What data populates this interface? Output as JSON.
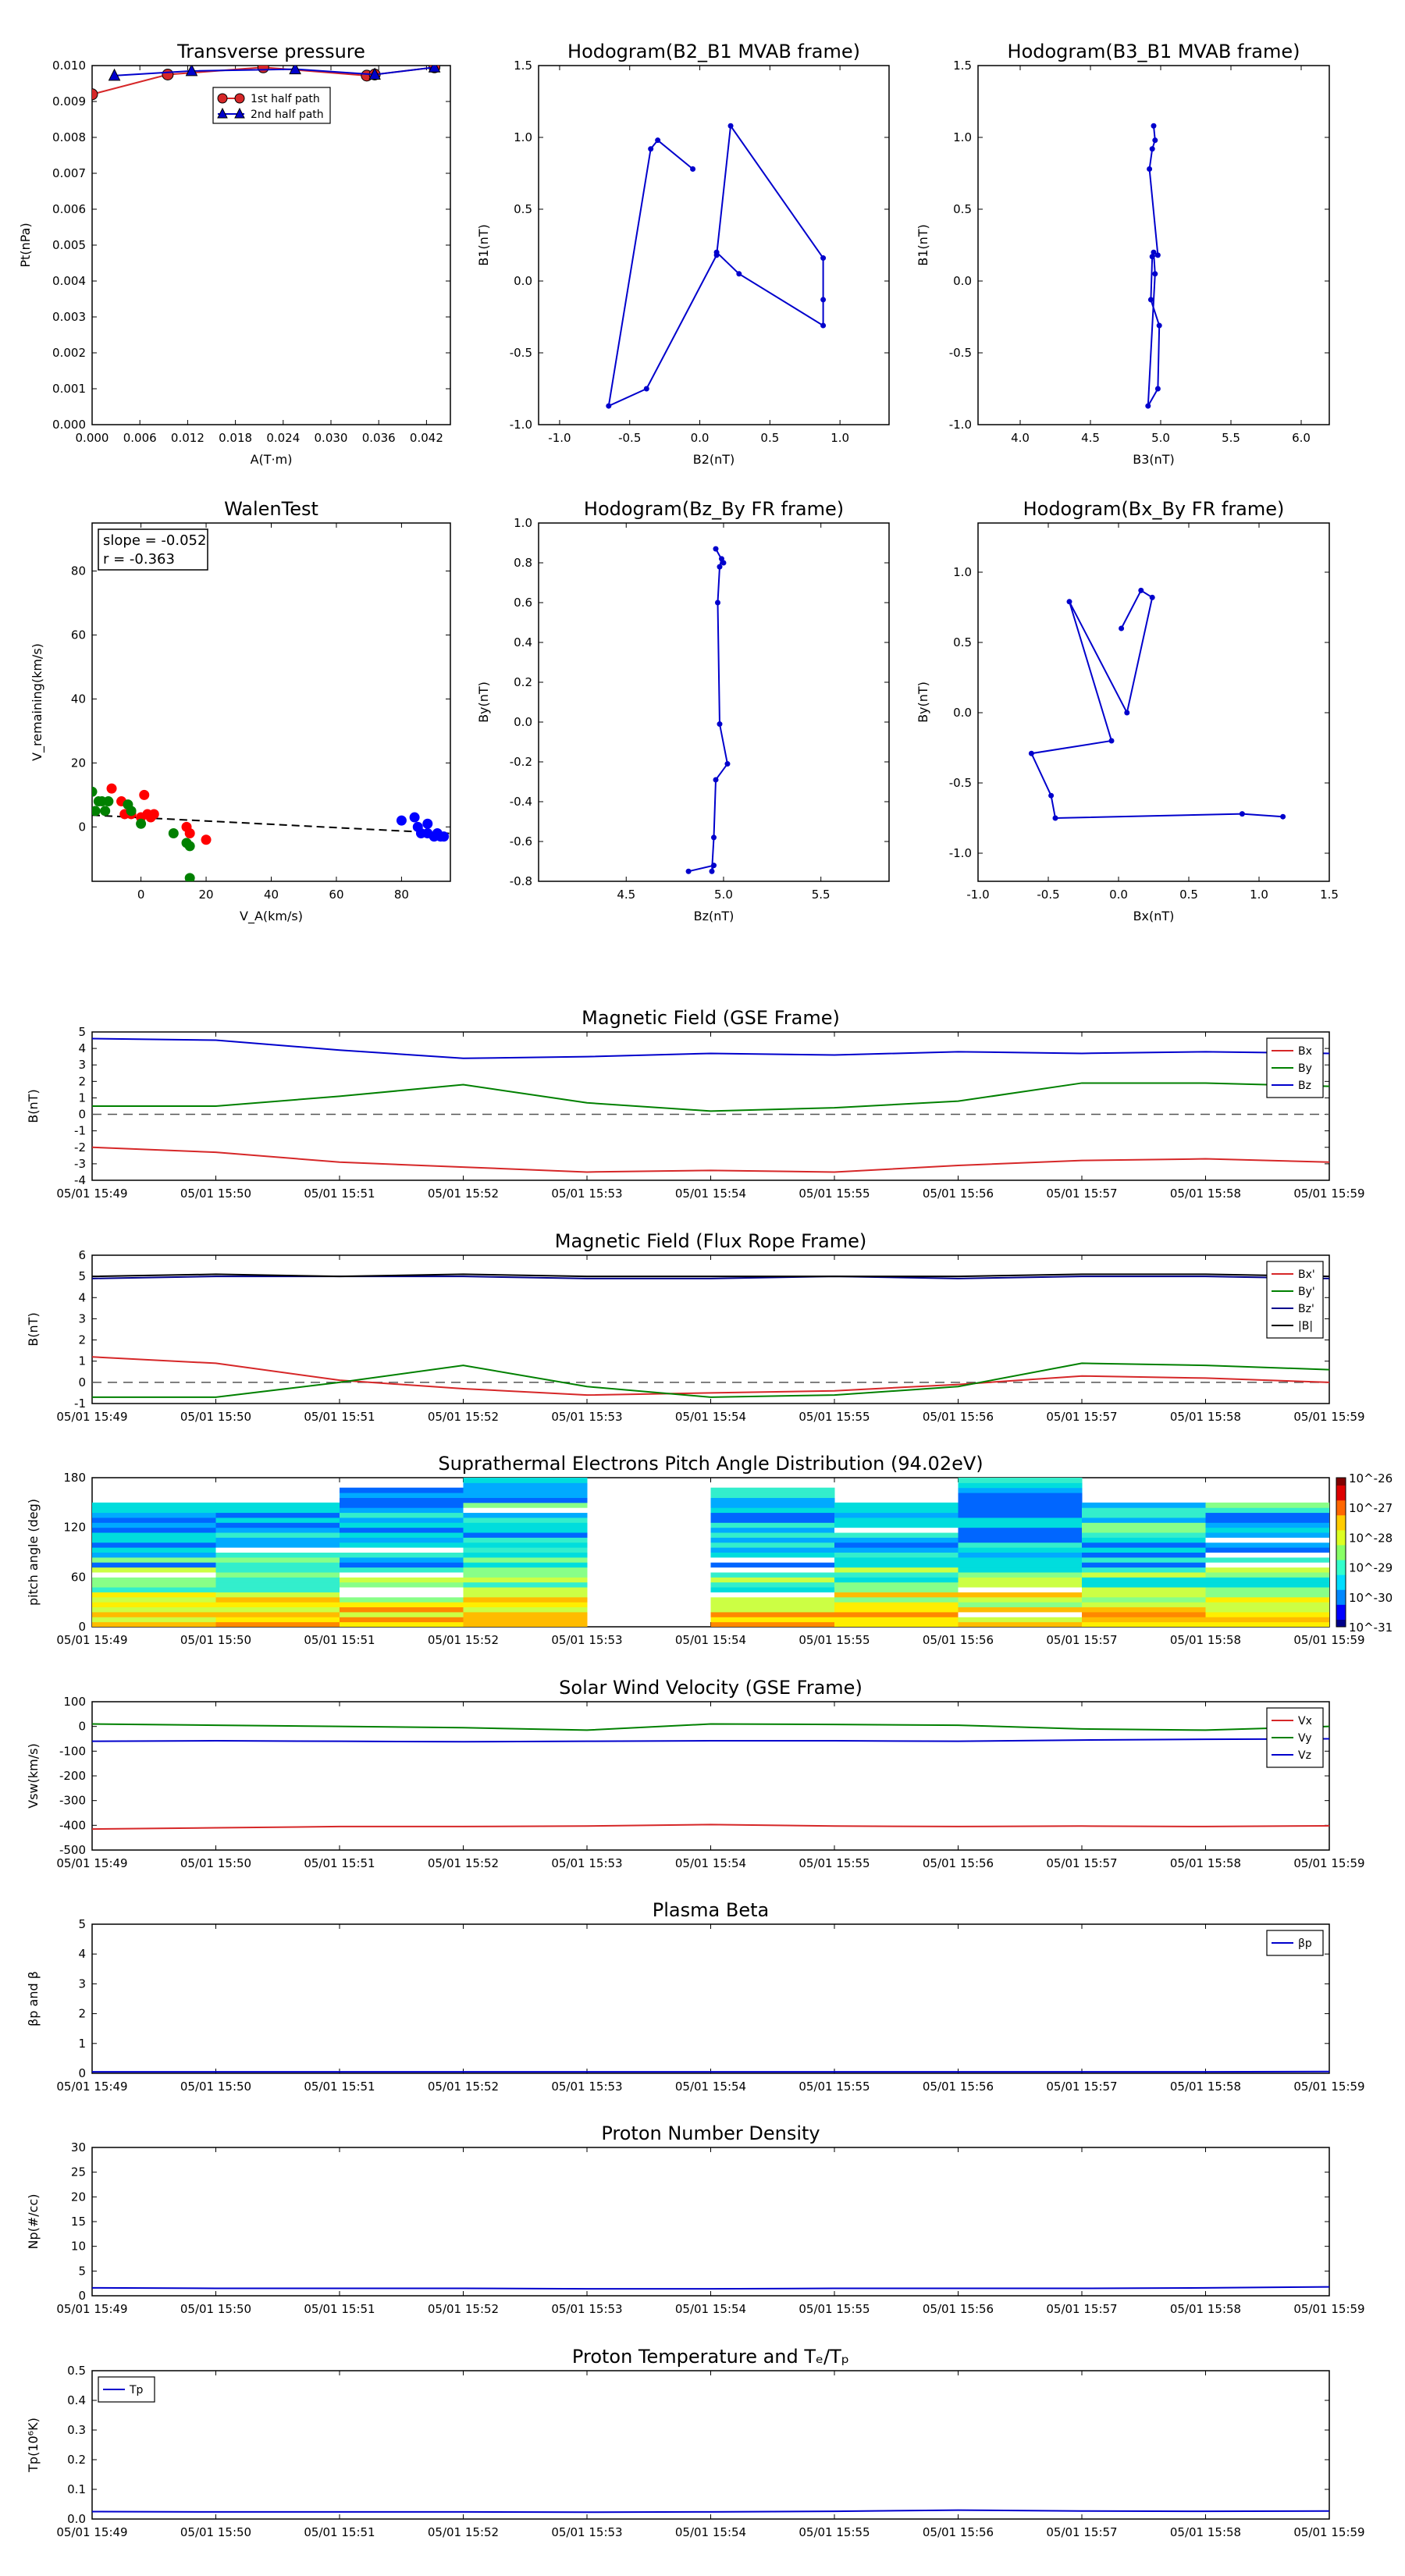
{
  "times": [
    "05/01 15:49",
    "05/01 15:50",
    "05/01 15:51",
    "05/01 15:52",
    "05/01 15:53",
    "05/01 15:54",
    "05/01 15:55",
    "05/01 15:56",
    "05/01 15:57",
    "05/01 15:58",
    "05/01 15:59"
  ],
  "chart_data": [
    {
      "id": "pt",
      "type": "line",
      "title": "Transverse pressure",
      "xlabel": "A(T·m)",
      "ylabel": "Pt(nPa)",
      "xlim": [
        0,
        0.045
      ],
      "ylim": [
        0,
        0.01
      ],
      "xticks": [
        "0.000",
        "0.006",
        "0.012",
        "0.018",
        "0.024",
        "0.030",
        "0.036",
        "0.042"
      ],
      "yticks": [
        "0.000",
        "0.001",
        "0.002",
        "0.003",
        "0.004",
        "0.005",
        "0.006",
        "0.007",
        "0.008",
        "0.009",
        "0.010"
      ],
      "legend": "top-center",
      "series": [
        {
          "name": "1st half path",
          "color": "#d62728",
          "marker": "circle",
          "x": [
            0.0,
            0.0095,
            0.0215,
            0.0345,
            0.0355,
            0.043
          ],
          "y": [
            0.0092,
            0.00975,
            0.00995,
            0.00972,
            0.00975,
            0.00995
          ]
        },
        {
          "name": "2nd half path",
          "color": "#0000cc",
          "marker": "triangle",
          "x": [
            0.0028,
            0.0125,
            0.0255,
            0.0355,
            0.043
          ],
          "y": [
            0.00972,
            0.00985,
            0.0099,
            0.00975,
            0.00995
          ]
        }
      ]
    },
    {
      "id": "hodo1",
      "type": "line",
      "title": "Hodogram(B2_B1 MVAB frame)",
      "xlabel": "B2(nT)",
      "ylabel": "B1(nT)",
      "xlim": [
        -1.15,
        1.35
      ],
      "ylim": [
        -1.0,
        1.5
      ],
      "xticks": [
        "-1.0",
        "-0.5",
        "0.0",
        "0.5",
        "1.0"
      ],
      "yticks": [
        "-1.0",
        "-0.5",
        "0.0",
        "0.5",
        "1.0",
        "1.5"
      ],
      "series": [
        {
          "color": "#0000cc",
          "x": [
            -0.05,
            -0.3,
            -0.35,
            -0.65,
            -0.38,
            0.12,
            0.22,
            0.88,
            0.88,
            0.88,
            0.28,
            0.12
          ],
          "y": [
            0.78,
            0.98,
            0.92,
            -0.87,
            -0.75,
            0.18,
            1.08,
            0.16,
            -0.13,
            -0.31,
            0.05,
            0.2
          ]
        }
      ]
    },
    {
      "id": "hodo2",
      "type": "line",
      "title": "Hodogram(B3_B1 MVAB frame)",
      "xlabel": "B3(nT)",
      "ylabel": "B1(nT)",
      "xlim": [
        3.7,
        6.2
      ],
      "ylim": [
        -1.0,
        1.5
      ],
      "xticks": [
        "4.0",
        "4.5",
        "5.0",
        "5.5",
        "6.0"
      ],
      "yticks": [
        "-1.0",
        "-0.5",
        "0.0",
        "0.5",
        "1.0",
        "1.5"
      ],
      "series": [
        {
          "color": "#0000cc",
          "x": [
            4.95,
            4.96,
            4.94,
            4.92,
            4.98,
            4.94,
            4.93,
            4.99,
            4.98,
            4.91,
            4.96,
            4.95
          ],
          "y": [
            1.08,
            0.98,
            0.92,
            0.78,
            0.18,
            0.17,
            -0.13,
            -0.31,
            -0.75,
            -0.87,
            0.05,
            0.2
          ]
        }
      ]
    },
    {
      "id": "walen",
      "type": "scatter",
      "title": "WalenTest",
      "xlabel": "V_A(km/s)",
      "ylabel": "V_remaining(km/s)",
      "xlim": [
        -15,
        95
      ],
      "ylim": [
        -17,
        95
      ],
      "xticks": [
        "0",
        "20",
        "40",
        "60",
        "80"
      ],
      "yticks": [
        "0",
        "20",
        "40",
        "60",
        "80"
      ],
      "xtick_values": [
        0,
        20,
        40,
        60,
        80
      ],
      "ytick_values": [
        0,
        20,
        40,
        60,
        80
      ],
      "annotation": {
        "slope": "slope = -0.052",
        "r": "r = -0.363"
      },
      "fit": {
        "slope": -0.052,
        "intercept": 2.9
      },
      "series": [
        {
          "color": "#ff0000",
          "x": [
            -9,
            -6,
            -5,
            -3,
            0,
            1,
            2,
            3,
            4,
            14,
            15,
            20
          ],
          "y": [
            12,
            8,
            4,
            4,
            3,
            10,
            4,
            3,
            4,
            0,
            -2,
            -4
          ]
        },
        {
          "color": "#008000",
          "x": [
            -15,
            -14,
            -13,
            -12,
            -11,
            -10,
            -4,
            -3,
            0,
            10,
            14,
            15,
            15
          ],
          "y": [
            11,
            5,
            8,
            8,
            5,
            8,
            7,
            5,
            1,
            -2,
            -5,
            -6,
            -16
          ]
        },
        {
          "color": "#0000ff",
          "x": [
            80,
            84,
            85,
            86,
            88,
            88,
            90,
            91,
            92,
            93
          ],
          "y": [
            2,
            3,
            0,
            -2,
            1,
            -2,
            -3,
            -2,
            -3,
            -3
          ]
        }
      ]
    },
    {
      "id": "hodo3",
      "type": "line",
      "title": "Hodogram(Bz_By FR frame)",
      "xlabel": "Bz(nT)",
      "ylabel": "By(nT)",
      "xlim": [
        4.05,
        5.85
      ],
      "ylim": [
        -0.8,
        1.0
      ],
      "xticks": [
        "4.5",
        "5.0",
        "5.5"
      ],
      "yticks": [
        "-0.8",
        "-0.6",
        "-0.4",
        "-0.2",
        "0.0",
        "0.2",
        "0.4",
        "0.6",
        "0.8",
        "1.0"
      ],
      "series": [
        {
          "color": "#0000cc",
          "x": [
            4.82,
            4.95,
            4.94,
            4.95,
            4.96,
            5.02,
            4.98,
            4.97,
            4.98,
            4.99,
            5.0,
            4.96
          ],
          "y": [
            -0.75,
            -0.72,
            -0.75,
            -0.58,
            -0.29,
            -0.21,
            -0.01,
            0.6,
            0.78,
            0.82,
            0.8,
            0.87
          ]
        }
      ]
    },
    {
      "id": "hodo4",
      "type": "line",
      "title": "Hodogram(Bx_By FR frame)",
      "xlabel": "Bx(nT)",
      "ylabel": "By(nT)",
      "xlim": [
        -1.0,
        1.5
      ],
      "ylim": [
        -1.2,
        1.35
      ],
      "xticks": [
        "-1.0",
        "-0.5",
        "0.0",
        "0.5",
        "1.0",
        "1.5"
      ],
      "yticks": [
        "-1.0",
        "-0.5",
        "0.0",
        "0.5",
        "1.0"
      ],
      "series": [
        {
          "color": "#0000cc",
          "x": [
            0.02,
            0.16,
            0.24,
            0.06,
            -0.35,
            -0.05,
            -0.62,
            -0.48,
            -0.45,
            0.88,
            1.17
          ],
          "y": [
            0.6,
            0.87,
            0.82,
            0.0,
            0.79,
            -0.2,
            -0.29,
            -0.59,
            -0.75,
            -0.72,
            -0.74
          ]
        }
      ]
    },
    {
      "id": "bgse",
      "type": "line",
      "title": "Magnetic Field (GSE Frame)",
      "xlabel": "",
      "ylabel": "B(nT)",
      "ylim": [
        -4,
        5
      ],
      "yticks": [
        "-4",
        "-3",
        "-2",
        "-1",
        "0",
        "1",
        "2",
        "3",
        "4",
        "5"
      ],
      "zero_line": true,
      "legend": "top-right",
      "series": [
        {
          "name": "Bx",
          "color": "#d62728",
          "values": [
            -2.0,
            -2.3,
            -2.9,
            -3.2,
            -3.5,
            -3.4,
            -3.5,
            -3.1,
            -2.8,
            -2.7,
            -2.9
          ]
        },
        {
          "name": "By",
          "color": "#008000",
          "values": [
            0.5,
            0.5,
            1.1,
            1.8,
            0.7,
            0.2,
            0.4,
            0.8,
            1.9,
            1.9,
            1.7
          ]
        },
        {
          "name": "Bz",
          "color": "#0000cc",
          "values": [
            4.6,
            4.5,
            3.9,
            3.4,
            3.5,
            3.7,
            3.6,
            3.8,
            3.7,
            3.8,
            3.7
          ]
        }
      ]
    },
    {
      "id": "bfr",
      "type": "line",
      "title": "Magnetic Field (Flux Rope Frame)",
      "xlabel": "",
      "ylabel": "B(nT)",
      "ylim": [
        -1,
        6
      ],
      "yticks": [
        "-1",
        "0",
        "1",
        "2",
        "3",
        "4",
        "5",
        "6"
      ],
      "zero_line": true,
      "legend": "top-right",
      "series": [
        {
          "name": "Bx'",
          "color": "#d62728",
          "values": [
            1.2,
            0.9,
            0.1,
            -0.3,
            -0.6,
            -0.5,
            -0.4,
            -0.1,
            0.3,
            0.2,
            0.0
          ]
        },
        {
          "name": "By'",
          "color": "#008000",
          "values": [
            -0.7,
            -0.7,
            0.0,
            0.8,
            -0.2,
            -0.7,
            -0.6,
            -0.2,
            0.9,
            0.8,
            0.6
          ]
        },
        {
          "name": "Bz'",
          "color": "#00008b",
          "values": [
            4.9,
            5.0,
            5.0,
            5.0,
            4.9,
            4.9,
            5.0,
            4.9,
            5.0,
            5.0,
            4.9
          ]
        },
        {
          "name": "|B|",
          "color": "#000000",
          "values": [
            5.0,
            5.1,
            5.0,
            5.1,
            5.0,
            5.0,
            5.0,
            5.0,
            5.1,
            5.1,
            5.0
          ]
        }
      ]
    },
    {
      "id": "pad",
      "type": "heatmap",
      "title": "Suprathermal Electrons Pitch Angle Distribution (94.02eV)",
      "xlabel": "",
      "ylabel": "pitch angle (deg)",
      "ylim": [
        0,
        180
      ],
      "yticks": [
        "0",
        "60",
        "120",
        "180"
      ],
      "colorbar": {
        "ticks": [
          "10^-26",
          "10^-27",
          "10^-28",
          "10^-29",
          "10^-30",
          "10^-31"
        ]
      },
      "gap_columns": [
        4
      ]
    },
    {
      "id": "vsw",
      "type": "line",
      "title": "Solar Wind Velocity (GSE Frame)",
      "xlabel": "",
      "ylabel": "Vsw(km/s)",
      "ylim": [
        -500,
        100
      ],
      "yticks": [
        "-500",
        "-400",
        "-300",
        "-200",
        "-100",
        "0",
        "100"
      ],
      "legend": "top-right",
      "series": [
        {
          "name": "Vx",
          "color": "#d62728",
          "values": [
            -415,
            -410,
            -405,
            -405,
            -403,
            -397,
            -403,
            -405,
            -403,
            -405,
            -402
          ]
        },
        {
          "name": "Vy",
          "color": "#008000",
          "values": [
            10,
            5,
            0,
            -5,
            -15,
            10,
            8,
            5,
            -10,
            -15,
            0
          ]
        },
        {
          "name": "Vz",
          "color": "#0000cc",
          "values": [
            -60,
            -58,
            -60,
            -62,
            -60,
            -58,
            -58,
            -60,
            -55,
            -52,
            -50
          ]
        }
      ]
    },
    {
      "id": "beta",
      "type": "line",
      "title": "Plasma Beta",
      "xlabel": "",
      "ylabel": "βp and β",
      "ylim": [
        0,
        5
      ],
      "yticks": [
        "0",
        "1",
        "2",
        "3",
        "4",
        "5"
      ],
      "legend": "top-right",
      "series": [
        {
          "name": "βp",
          "color": "#0000cc",
          "values": [
            0.05,
            0.05,
            0.05,
            0.05,
            0.05,
            0.05,
            0.05,
            0.05,
            0.05,
            0.05,
            0.06
          ]
        }
      ]
    },
    {
      "id": "np",
      "type": "line",
      "title": "Proton Number Density",
      "xlabel": "",
      "ylabel": "Np(#/cc)",
      "ylim": [
        0,
        30
      ],
      "yticks": [
        "0",
        "5",
        "10",
        "15",
        "20",
        "25",
        "30"
      ],
      "series": [
        {
          "color": "#0000cc",
          "values": [
            1.6,
            1.5,
            1.5,
            1.5,
            1.4,
            1.4,
            1.5,
            1.5,
            1.5,
            1.6,
            1.8
          ]
        }
      ]
    },
    {
      "id": "tp",
      "type": "line",
      "title": "Proton Temperature and Tₑ/Tₚ",
      "xlabel": "",
      "ylabel": "Tp(10⁶K)",
      "ylim": [
        0,
        0.5
      ],
      "yticks": [
        "0.0",
        "0.1",
        "0.2",
        "0.3",
        "0.4",
        "0.5"
      ],
      "legend": "top-left",
      "series": [
        {
          "name": "Tp",
          "color": "#0000cc",
          "values": [
            0.025,
            0.024,
            0.024,
            0.024,
            0.023,
            0.024,
            0.026,
            0.03,
            0.027,
            0.026,
            0.027
          ]
        }
      ]
    }
  ]
}
